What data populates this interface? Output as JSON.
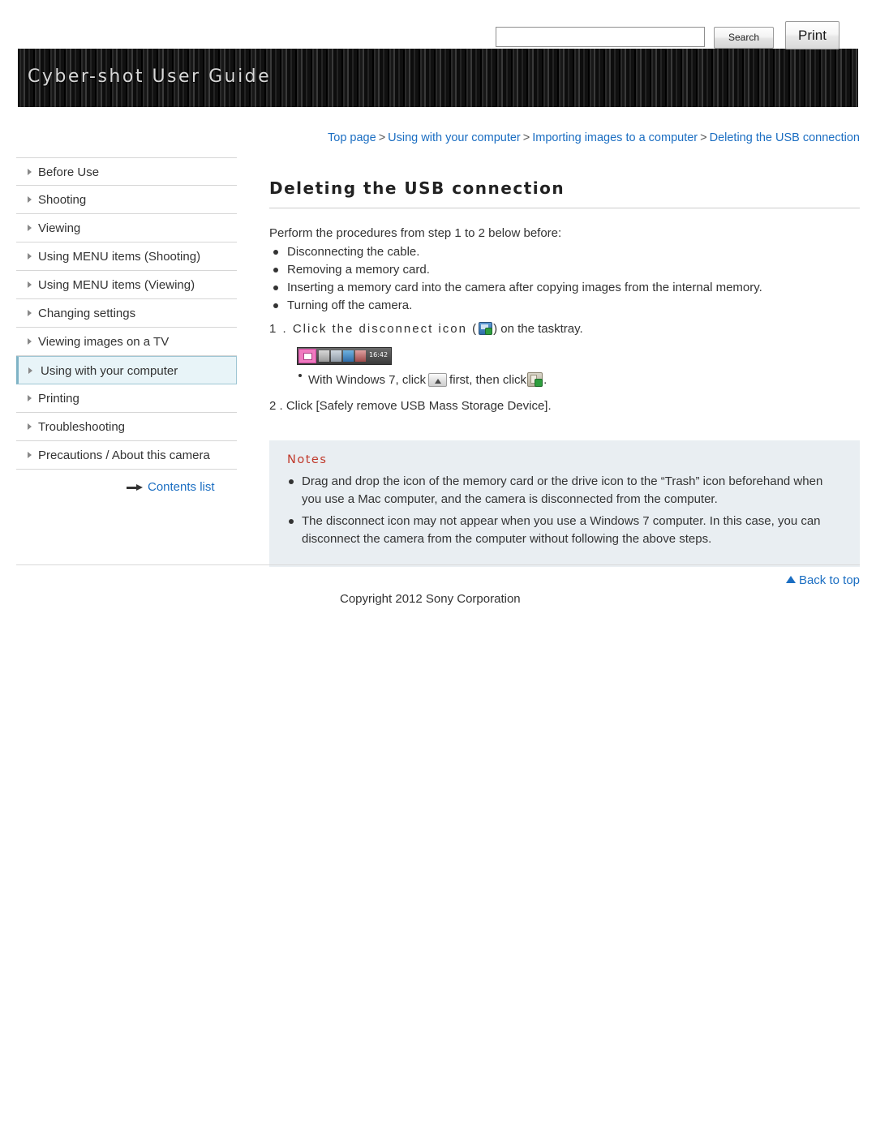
{
  "header": {
    "title": "Cyber-shot User Guide",
    "search_value": "",
    "search_placeholder": "",
    "search_label": "Search",
    "print_label": "Print"
  },
  "breadcrumb": {
    "items": [
      "Top page",
      "Using with your computer",
      "Importing images to a computer",
      "Deleting the USB connection"
    ],
    "separator": ">"
  },
  "sidebar": {
    "items": [
      {
        "label": "Before Use",
        "selected": false
      },
      {
        "label": "Shooting",
        "selected": false
      },
      {
        "label": "Viewing",
        "selected": false
      },
      {
        "label": "Using MENU items (Shooting)",
        "selected": false
      },
      {
        "label": "Using MENU items (Viewing)",
        "selected": false
      },
      {
        "label": "Changing settings",
        "selected": false
      },
      {
        "label": "Viewing images on a TV",
        "selected": false
      },
      {
        "label": "Using with your computer",
        "selected": true
      },
      {
        "label": "Printing",
        "selected": false
      },
      {
        "label": "Troubleshooting",
        "selected": false
      },
      {
        "label": "Precautions / About this camera",
        "selected": false
      }
    ],
    "contents_list": "Contents list"
  },
  "main": {
    "title": "Deleting the USB connection",
    "intro": "Perform the procedures from step 1 to 2 below before:",
    "bullets": [
      "Disconnecting the cable.",
      "Removing a memory card.",
      "Inserting a memory card into the camera after copying images from the internal memory.",
      "Turning off the camera."
    ],
    "step1_pre": "1 .  Click the disconnect icon (",
    "step1_post": ") on the tasktray.",
    "taskbar_time": "16:42",
    "subnote_pre": "With Windows 7, click",
    "subnote_mid": "first, then click",
    "subnote_post": ".",
    "step2": "2 .  Click [Safely remove USB Mass Storage Device]."
  },
  "notes": {
    "title": "Notes",
    "items": [
      "Drag and drop the icon of the memory card or the drive icon to the “Trash” icon beforehand when you use a Mac computer, and the camera is disconnected from the computer.",
      "The disconnect icon may not appear when you use a Windows 7 computer. In this case, you can disconnect the camera from the computer without following the above steps."
    ]
  },
  "footer": {
    "back_to_top": "Back to top",
    "copyright": "Copyright 2012 Sony Corporation"
  },
  "colors": {
    "link": "#1b6ec2",
    "notes_title": "#c0392b",
    "notes_bg": "#e9eef2",
    "selected_bg": "#e8f4f8"
  }
}
